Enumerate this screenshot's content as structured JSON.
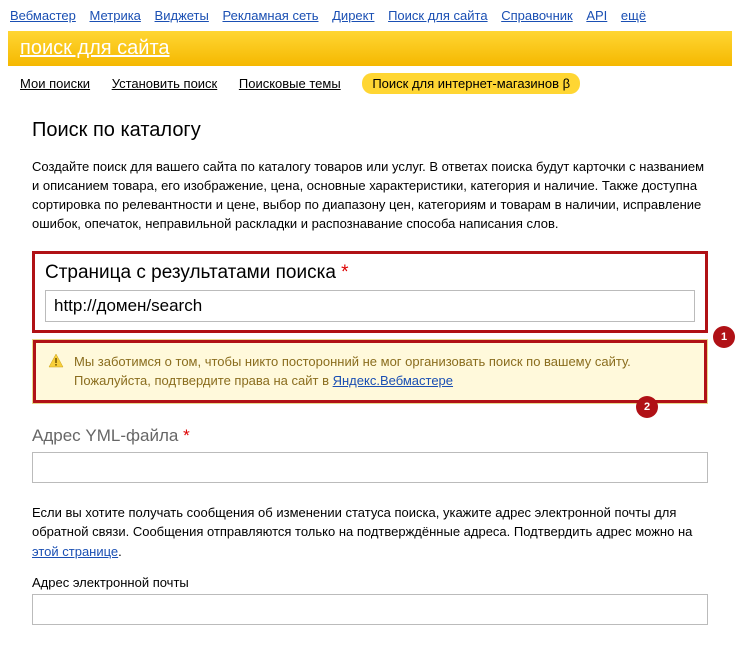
{
  "topnav": {
    "items": [
      "Вебмастер",
      "Метрика",
      "Виджеты",
      "Рекламная сеть",
      "Директ",
      "Поиск для сайта",
      "Справочник",
      "API",
      "ещё"
    ]
  },
  "yellowBar": {
    "title": "поиск для сайта"
  },
  "subnav": {
    "items": [
      "Мои поиски",
      "Установить поиск",
      "Поисковые темы"
    ],
    "pill": "Поиск для интернет-магазинов β"
  },
  "heading": "Поиск по каталогу",
  "description": "Создайте поиск для вашего сайта по каталогу товаров или услуг. В ответах поиска будут карточки с названием и описанием товара, его изображение, цена, основные характеристики, категория и наличие. Также доступна сортировка по релевантности и цене, выбор по диапазону цен, категориям и товарам в наличии, исправление ошибок, опечаток, неправильной раскладки и распознавание способа написания слов.",
  "section1": {
    "label": "Страница с результатами поиска",
    "star": "*",
    "value": "http://домен/search",
    "marker": "1"
  },
  "warning": {
    "text1": "Мы заботимся о том, чтобы никто посторонний не мог организовать поиск по вашему сайту. Пожалуйста, подтвердите права на сайт в ",
    "link": "Яндекс.Вебмастере",
    "marker": "2"
  },
  "section2": {
    "label": "Адрес YML-файла",
    "star": "*"
  },
  "emailInfo": {
    "text1": "Если вы хотите получать сообщения об изменении статуса поиска, укажите адрес электронной почты для обратной связи. Сообщения отправляются только на подтверждённые адреса. Подтвердить адрес можно на ",
    "link": "этой странице",
    "period": "."
  },
  "emailLabel": "Адрес электронной почты"
}
